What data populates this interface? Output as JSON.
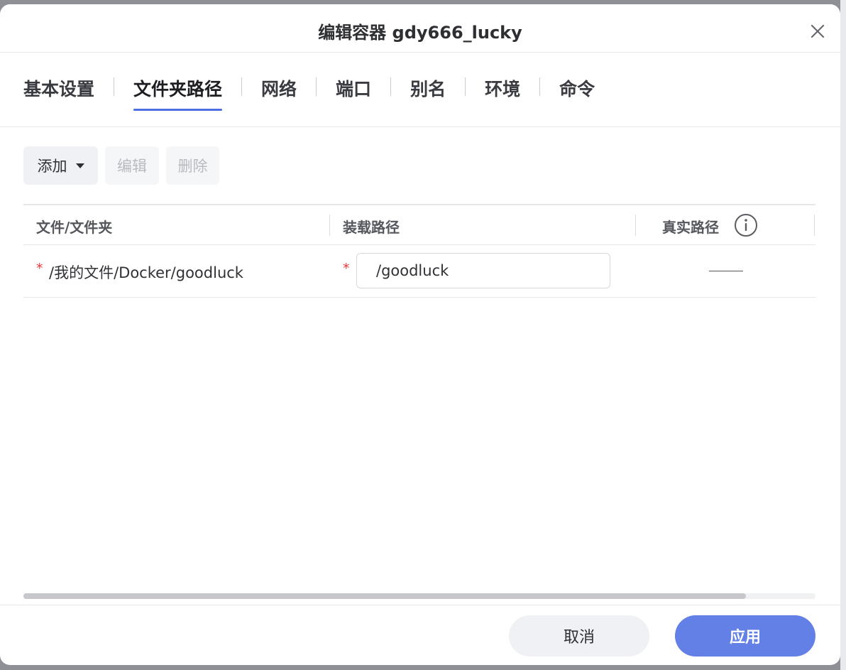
{
  "dialog": {
    "title": "编辑容器 gdy666_lucky",
    "close_icon": "close-icon"
  },
  "tabs": [
    {
      "label": "基本设置",
      "active": false
    },
    {
      "label": "文件夹路径",
      "active": true
    },
    {
      "label": "网络",
      "active": false
    },
    {
      "label": "端口",
      "active": false
    },
    {
      "label": "别名",
      "active": false
    },
    {
      "label": "环境",
      "active": false
    },
    {
      "label": "命令",
      "active": false
    }
  ],
  "toolbar": {
    "add_label": "添加",
    "edit_label": "编辑",
    "delete_label": "删除"
  },
  "table": {
    "columns": [
      "文件/文件夹",
      "装载路径",
      "真实路径"
    ],
    "rows": [
      {
        "file": "/我的文件/Docker/goodluck",
        "mount_path": "/goodluck",
        "real_path": "——"
      }
    ],
    "required_mark": "*"
  },
  "scrollbar": {
    "position_fraction": 0.0,
    "visible_fraction": 0.91
  },
  "footer": {
    "cancel_label": "取消",
    "apply_label": "应用"
  },
  "colors": {
    "accent": "#4f6ee6",
    "apply_button": "#6380e6",
    "required": "#e23b3b"
  }
}
